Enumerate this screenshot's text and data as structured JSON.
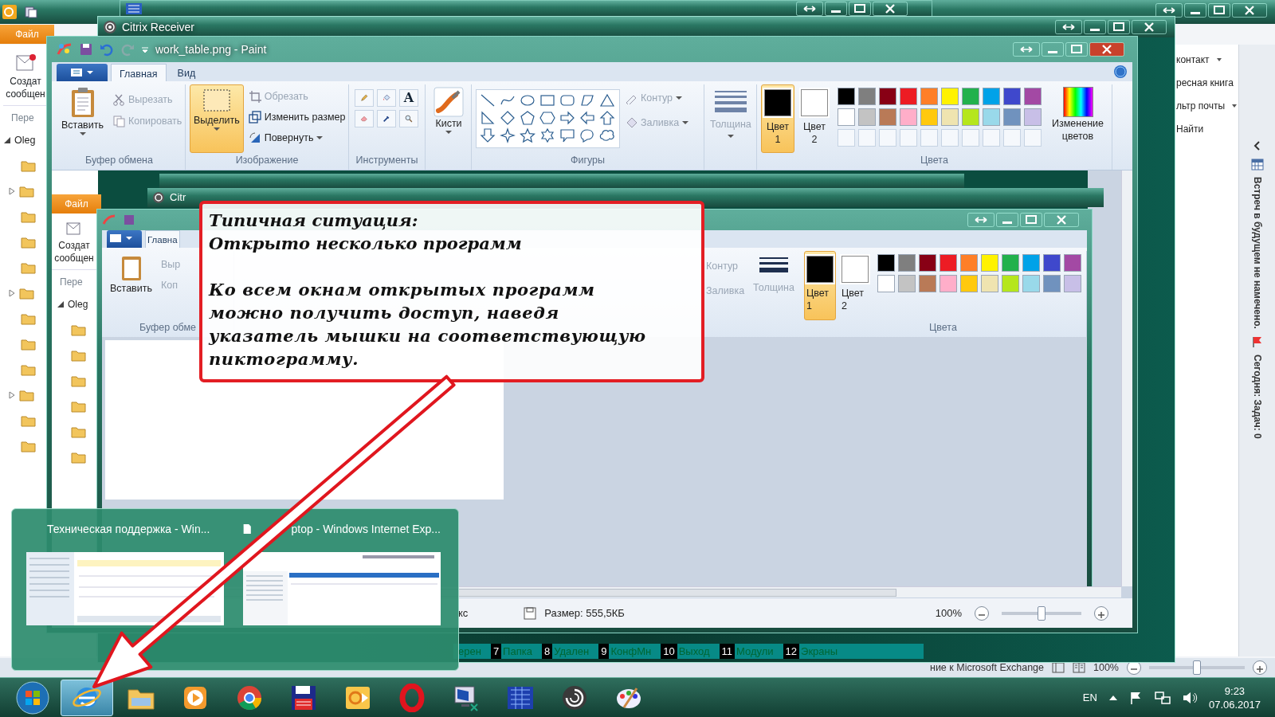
{
  "outlook": {
    "file_tab": "Файл",
    "new_message": "Создат сообщен",
    "nav_header": "Пере",
    "account": "Oleg",
    "ribbon_items": [
      {
        "label": "контакт",
        "dropdown": true
      },
      {
        "label": "ресная книга",
        "dropdown": false
      },
      {
        "label": "льтр почты",
        "dropdown": true
      },
      {
        "label": "Найти",
        "dropdown": false
      }
    ],
    "todo_bar": {
      "appointments": "Встреч в будущем не намечено.",
      "tasks": "Сегодня: Задач: 0"
    },
    "status_bar": {
      "text": "ние к Microsoft Exchange",
      "zoom": "100%",
      "level": 0.5
    }
  },
  "citrix": {
    "title": "Citrix Receiver",
    "key_bar": [
      {
        "label": "ерен"
      },
      {
        "key": "7",
        "label": "Папка"
      },
      {
        "key": "8",
        "label": "Удален"
      },
      {
        "key": "9",
        "label": "КонфМн"
      },
      {
        "key": "10",
        "label": "Выход"
      },
      {
        "key": "11",
        "label": "Модули"
      },
      {
        "key": "12",
        "label": "Экраны"
      }
    ]
  },
  "paint": {
    "title": "work_table.png - Paint",
    "tabs": [
      {
        "label": "Главная",
        "selected": true
      },
      {
        "label": "Вид",
        "selected": false
      }
    ],
    "clipboard": {
      "paste": "Вставить",
      "items": [
        {
          "label": "Вырезать",
          "disabled": true
        },
        {
          "label": "Копировать",
          "disabled": true
        }
      ],
      "group": "Буфер обмена"
    },
    "image": {
      "select": {
        "label": "Выделить",
        "selected": true
      },
      "items": [
        {
          "label": "Обрезать",
          "disabled": true
        },
        {
          "label": "Изменить размер",
          "disabled": false
        },
        {
          "label": "Повернуть",
          "disabled": false
        }
      ],
      "group": "Изображение"
    },
    "tools": {
      "text_tool": "A",
      "group": "Инструменты"
    },
    "brushes": "Кисти",
    "shapes": {
      "group": "Фигуры",
      "outline": {
        "label": "Контур",
        "disabled": true
      },
      "fill": {
        "label": "Заливка",
        "disabled": true
      }
    },
    "size": {
      "label": "Толщина",
      "disabled": true
    },
    "colors": {
      "slots": [
        {
          "label": "Цвет 1",
          "selected": true,
          "color": "#000000"
        },
        {
          "label": "Цвет 2",
          "selected": false,
          "color": "#ffffff"
        }
      ],
      "palette": [
        {
          "color": "#000000"
        },
        {
          "color": "#7f7f7f"
        },
        {
          "color": "#880015"
        },
        {
          "color": "#ed1c24"
        },
        {
          "color": "#ff7f27"
        },
        {
          "color": "#fff200"
        },
        {
          "color": "#22b14c"
        },
        {
          "color": "#00a2e8"
        },
        {
          "color": "#3f48cc"
        },
        {
          "color": "#a349a4"
        },
        {
          "color": "#ffffff"
        },
        {
          "color": "#c3c3c3"
        },
        {
          "color": "#b97a57"
        },
        {
          "color": "#ffaec9"
        },
        {
          "color": "#ffc90e"
        },
        {
          "color": "#efe4b0"
        },
        {
          "color": "#b5e61d"
        },
        {
          "color": "#99d9ea"
        },
        {
          "color": "#7092be"
        },
        {
          "color": "#c8bfe7"
        }
      ],
      "edit": "Изменение цветов",
      "group": "Цвета"
    },
    "status_bar": {
      "left": "кс",
      "size": "Размер: 555,5КБ",
      "zoom": "100%",
      "level": 0.5
    }
  },
  "inner_screenshot": {
    "file_tab": "Файл",
    "new_message": "Создат сообщен",
    "nav_header": "Пере",
    "account": "Oleg",
    "citrix_title": "Citr",
    "paint_tabs": [
      {
        "label": "Главна",
        "selected": true
      }
    ],
    "paste": "Вставить",
    "cut": "Выр",
    "copy": "Коп",
    "clipboard_group": "Буфер обме",
    "outline": "Контур",
    "fill": "Заливка",
    "size": "Толщина",
    "color_slots": [
      {
        "label": "Цвет 1",
        "selected": true
      },
      {
        "label": "Цвет 2",
        "selected": false
      }
    ],
    "colors_group": "Цвета"
  },
  "callout": {
    "heading": "Типичная ситуация:\nОткрыто несколько программ",
    "body": "Ко всем окнам открытых программ\nможно получить доступ, наведя\nуказатель мышки на соответствующую\nпиктограмму."
  },
  "thumbnails": [
    {
      "title": "Техническая поддержка - Win..."
    },
    {
      "title": "ptop - Windows Internet Exp..."
    }
  ],
  "taskbar": {
    "apps": [
      {
        "kind": "ie",
        "selected": true
      },
      {
        "kind": "explorer",
        "selected": false
      },
      {
        "kind": "media",
        "selected": false
      },
      {
        "kind": "chrome",
        "selected": false
      },
      {
        "kind": "floppy",
        "selected": false
      },
      {
        "kind": "outlook",
        "selected": false
      },
      {
        "kind": "opera",
        "selected": false
      },
      {
        "kind": "remote",
        "selected": false
      },
      {
        "kind": "grid",
        "selected": false
      },
      {
        "kind": "citrix",
        "selected": false
      },
      {
        "kind": "paint",
        "selected": false
      }
    ],
    "tray": {
      "language": "EN",
      "time": "9:23",
      "date": "07.06.2017"
    }
  }
}
